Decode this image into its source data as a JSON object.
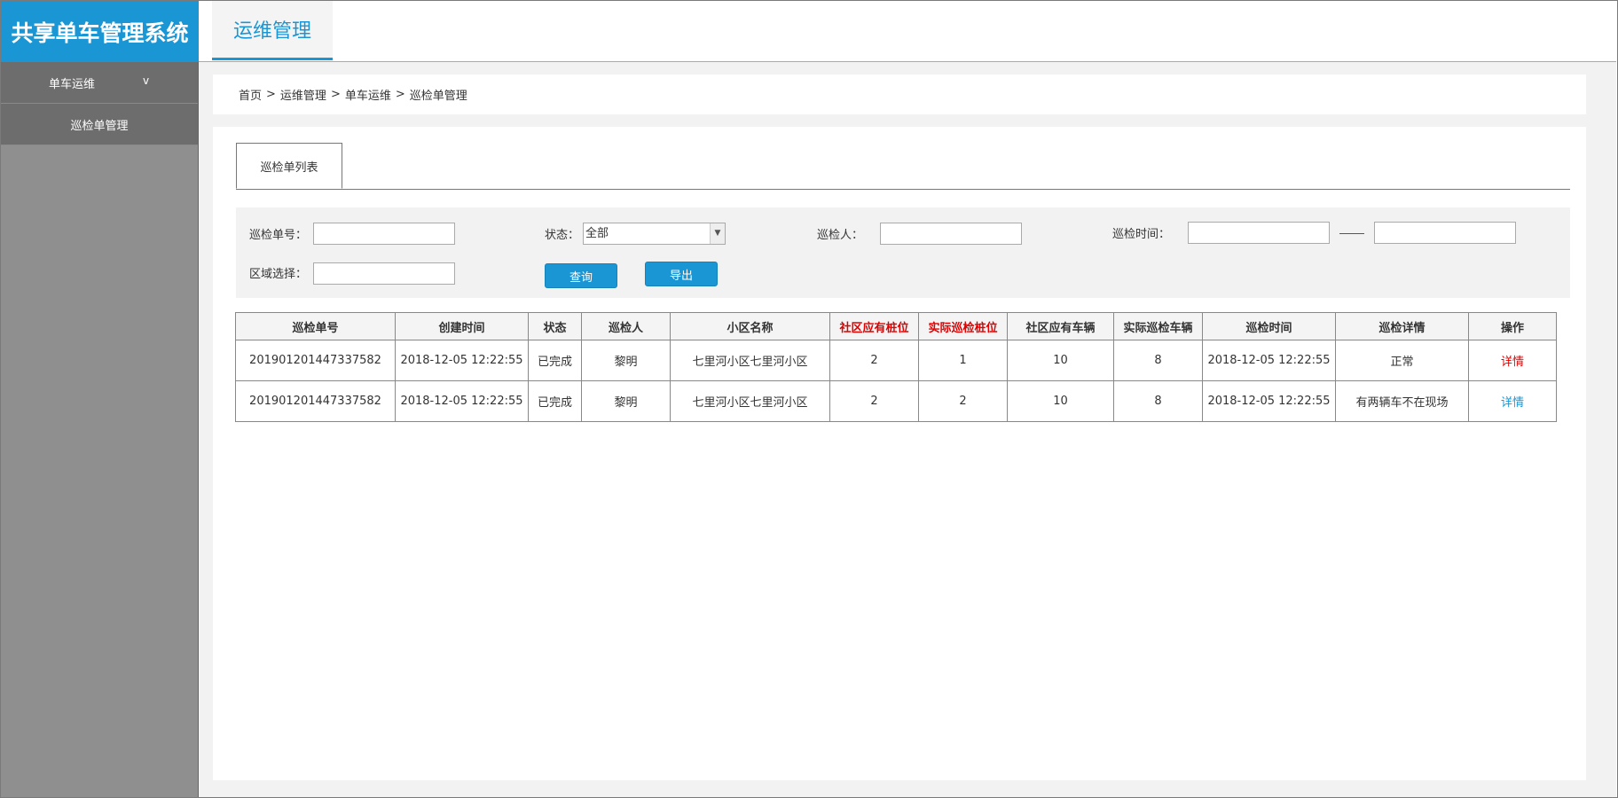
{
  "app": {
    "title": "共享单车管理系统"
  },
  "header": {
    "active_tab": "运维管理"
  },
  "sidebar": {
    "group": {
      "label": "单车运维",
      "chevron": "v"
    },
    "items": [
      {
        "label": "巡检单管理"
      }
    ]
  },
  "breadcrumb": {
    "items": [
      "首页",
      "运维管理",
      "单车运维",
      "巡检单管理"
    ],
    "separator": ">"
  },
  "tabs": [
    {
      "label": "巡检单列表"
    }
  ],
  "filters": {
    "order_no_label": "巡检单号：",
    "status_label": "状态：",
    "status_value": "全部",
    "inspector_label": "巡检人：",
    "time_label": "巡检时间：",
    "region_label": "区域选择："
  },
  "buttons": {
    "query": "查询",
    "export": "导出"
  },
  "table": {
    "headers": [
      "巡检单号",
      "创建时间",
      "状态",
      "巡检人",
      "小区名称",
      "社区应有桩位",
      "实际巡检桩位",
      "社区应有车辆",
      "实际巡检车辆",
      "巡检时间",
      "巡检详情",
      "操作"
    ],
    "rows": [
      [
        "201901201447337582",
        "2018-12-05 12:22:55",
        "已完成",
        "黎明",
        "七里河小区七里河小区",
        "2",
        "1",
        "10",
        "8",
        "2018-12-05 12:22:55",
        "正常",
        "详情"
      ],
      [
        "201901201447337582",
        "2018-12-05 12:22:55",
        "已完成",
        "黎明",
        "七里河小区七里河小区",
        "2",
        "2",
        "10",
        "8",
        "2018-12-05 12:22:55",
        "有两辆车不在现场",
        "详情"
      ]
    ]
  },
  "colors": {
    "accent": "#1a96d4",
    "warning": "#e00000"
  }
}
